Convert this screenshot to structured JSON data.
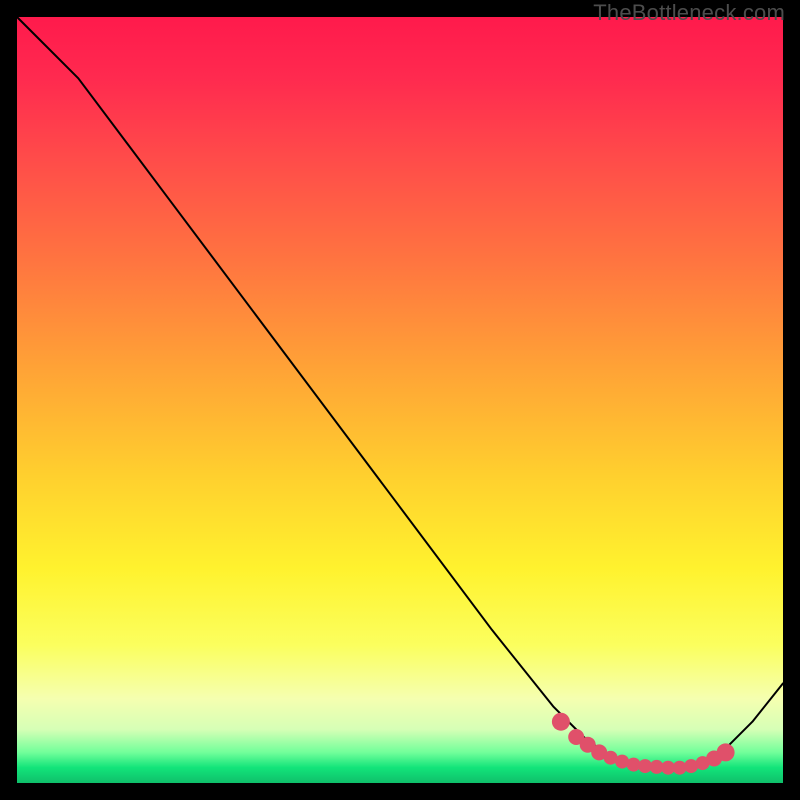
{
  "watermark": "TheBottleneck.com",
  "chart_data": {
    "type": "line",
    "title": "",
    "xlabel": "",
    "ylabel": "",
    "xlim": [
      0,
      100
    ],
    "ylim": [
      0,
      100
    ],
    "series": [
      {
        "name": "main-curve",
        "x": [
          0,
          3,
          8,
          20,
          35,
          50,
          62,
          70,
          74,
          78,
          82,
          86,
          88,
          90,
          93,
          96,
          100
        ],
        "values": [
          100,
          97,
          92,
          76,
          56,
          36,
          20,
          10,
          6,
          3,
          2,
          2,
          2.5,
          3,
          5,
          8,
          13
        ]
      }
    ],
    "marker_cluster": {
      "x": [
        71,
        73,
        74.5,
        76,
        77.5,
        79,
        80.5,
        82,
        83.5,
        85,
        86.5,
        88,
        89.5,
        91,
        92.5
      ],
      "values": [
        8,
        6,
        5,
        4,
        3.3,
        2.8,
        2.4,
        2.2,
        2.1,
        2,
        2,
        2.2,
        2.6,
        3.2,
        4
      ],
      "sizes": [
        9,
        8,
        8,
        8,
        7,
        7,
        7,
        7,
        7,
        7,
        7,
        7,
        7,
        8,
        9
      ]
    },
    "colors": {
      "curve": "#000000",
      "markers": "#e0506a",
      "top": "#ff1a4c",
      "mid": "#ffd02e",
      "bottom": "#0fbf6a"
    }
  }
}
